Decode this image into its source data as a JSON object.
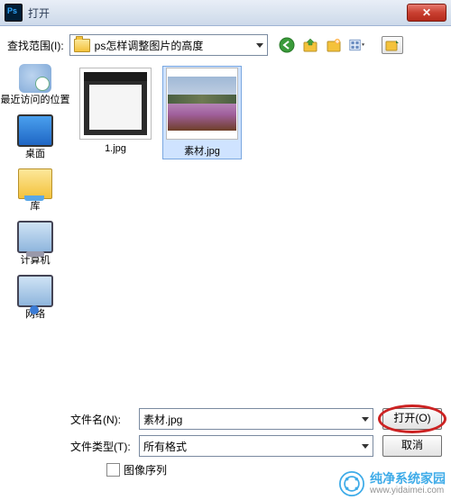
{
  "window": {
    "title": "打开"
  },
  "toolbar": {
    "lookin_label": "查找范围(I):",
    "current_folder": "ps怎样调整图片的高度",
    "icons": {
      "back": "back-icon",
      "up": "up-icon",
      "new_folder": "new-folder-icon",
      "view": "view-icon",
      "extra": "extra-icon"
    }
  },
  "places": [
    {
      "id": "recent",
      "label": "最近访问的位置"
    },
    {
      "id": "desktop",
      "label": "桌面"
    },
    {
      "id": "library",
      "label": "库"
    },
    {
      "id": "computer",
      "label": "计算机"
    },
    {
      "id": "network",
      "label": "网络"
    }
  ],
  "files": [
    {
      "name": "1.jpg",
      "selected": false,
      "kind": "psdoc"
    },
    {
      "name": "素材.jpg",
      "selected": true,
      "kind": "landscape"
    }
  ],
  "bottom": {
    "filename_label": "文件名(N):",
    "filename_value": "素材.jpg",
    "filetype_label": "文件类型(T):",
    "filetype_value": "所有格式",
    "open_label": "打开(O)",
    "cancel_label": "取消",
    "image_sequence_label": "图像序列"
  },
  "watermark": {
    "line1": "纯净系统家园",
    "line2": "www.yidaimei.com"
  }
}
